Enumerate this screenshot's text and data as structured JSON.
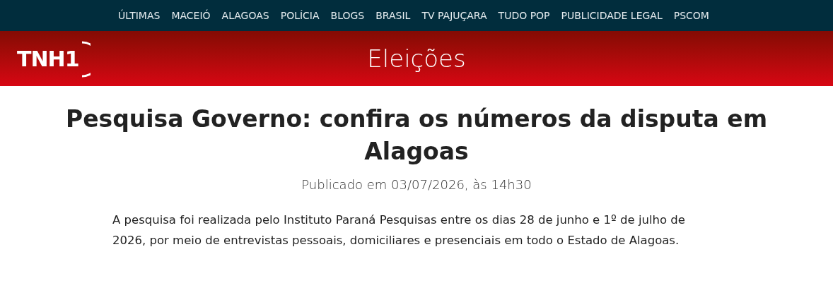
{
  "nav": [
    "ÚLTIMAS",
    "MACEIÓ",
    "ALAGOAS",
    "POLÍCIA",
    "BLOGS",
    "BRASIL",
    "TV PAJUÇARA",
    "TUDO POP",
    "PUBLICIDADE LEGAL",
    "PSCOM"
  ],
  "header": {
    "logo": "TNH1",
    "section": "Eleições"
  },
  "article": {
    "title": "Pesquisa Governo: confira os números da disputa em Alagoas",
    "published": "Publicado em 03/07/2026, às 14h30",
    "body": "A pesquisa foi realizada pelo Instituto Paraná Pesquisas entre os dias 28 de junho e 1º de julho de 2026, por meio de entrevistas pessoais, domiciliares e presenciais em todo o Estado de Alagoas."
  }
}
